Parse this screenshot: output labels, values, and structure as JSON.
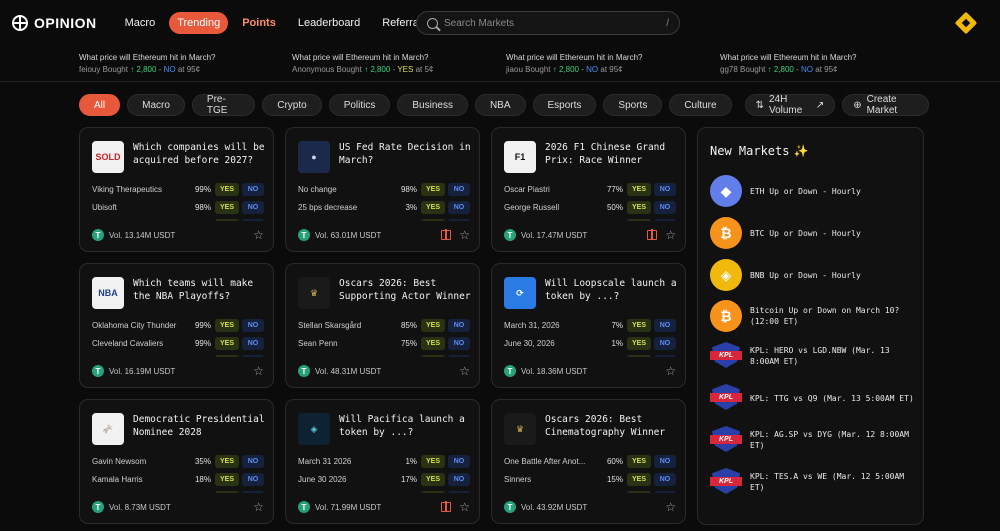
{
  "header": {
    "logo": "OPINION",
    "nav": [
      {
        "label": "Macro"
      },
      {
        "label": "Trending"
      },
      {
        "label": "Points"
      },
      {
        "label": "Leaderboard"
      },
      {
        "label": "Referral"
      }
    ],
    "search_placeholder": "Search Markets",
    "search_shortcut": "/"
  },
  "ticker": [
    {
      "question": "What price will Ethereum hit in March?",
      "user": "feiouy",
      "bought": "Bought",
      "arrow": "↑",
      "amount": "2,800",
      "dash": "-",
      "side": "NO",
      "at": "at 95¢"
    },
    {
      "question": "What price will Ethereum hit in March?",
      "user": "Anonymous",
      "bought": "Bought",
      "arrow": "↑",
      "amount": "2,800",
      "dash": "-",
      "side": "YES",
      "at": "at 5¢"
    },
    {
      "question": "What price will Ethereum hit in March?",
      "user": "jiaou",
      "bought": "Bought",
      "arrow": "↑",
      "amount": "2,800",
      "dash": "-",
      "side": "NO",
      "at": "at 95¢"
    },
    {
      "question": "What price will Ethereum hit in March?",
      "user": "gg78",
      "bought": "Bought",
      "arrow": "↑",
      "amount": "2,800",
      "dash": "-",
      "side": "NO",
      "at": "at 95¢"
    }
  ],
  "filters": [
    "All",
    "Macro",
    "Pre-TGE",
    "Crypto",
    "Politics",
    "Business",
    "NBA",
    "Esports",
    "Sports",
    "Culture"
  ],
  "sort_label": "24H Volume",
  "create_label": "Create Market",
  "yes_label": "YES",
  "no_label": "NO",
  "cards": [
    {
      "title": "Which companies will be acquired before 2027?",
      "thumb": "SOLD",
      "rows": [
        {
          "name": "Viking Therapeutics",
          "pct": "99%"
        },
        {
          "name": "Ubisoft",
          "pct": "98%"
        },
        {
          "name": "",
          "pct": ""
        }
      ],
      "volume": "Vol. 13.14M USDT",
      "gift": false
    },
    {
      "title": "US Fed Rate Decision in March?",
      "thumb": "",
      "rows": [
        {
          "name": "No change",
          "pct": "98%"
        },
        {
          "name": "25 bps decrease",
          "pct": "3%"
        },
        {
          "name": "",
          "pct": ""
        }
      ],
      "volume": "Vol. 63.01M USDT",
      "gift": true
    },
    {
      "title": "2026 F1 Chinese Grand Prix: Race Winner",
      "thumb": "F1",
      "rows": [
        {
          "name": "Oscar Piastri",
          "pct": "77%"
        },
        {
          "name": "George Russell",
          "pct": "50%"
        },
        {
          "name": "",
          "pct": ""
        }
      ],
      "volume": "Vol. 17.47M USDT",
      "gift": true
    },
    {
      "title": "Which teams will make the NBA Playoffs?",
      "thumb": "NBA",
      "rows": [
        {
          "name": "Oklahoma City Thunder",
          "pct": "99%"
        },
        {
          "name": "Cleveland Cavaliers",
          "pct": "99%"
        },
        {
          "name": "",
          "pct": ""
        }
      ],
      "volume": "Vol. 16.19M USDT",
      "gift": false
    },
    {
      "title": "Oscars 2026: Best Supporting Actor Winner",
      "thumb": "",
      "rows": [
        {
          "name": "Stellan Skarsgård",
          "pct": "85%"
        },
        {
          "name": "Sean Penn",
          "pct": "75%"
        },
        {
          "name": "",
          "pct": ""
        }
      ],
      "volume": "Vol. 48.31M USDT",
      "gift": false
    },
    {
      "title": "Will Loopscale launch a token by ...?",
      "thumb": "",
      "rows": [
        {
          "name": "March 31, 2026",
          "pct": "7%"
        },
        {
          "name": "June 30, 2026",
          "pct": "1%"
        },
        {
          "name": "",
          "pct": ""
        }
      ],
      "volume": "Vol. 18.36M USDT",
      "gift": false
    },
    {
      "title": "Democratic Presidential Nominee 2028",
      "thumb": "",
      "rows": [
        {
          "name": "Gavin Newsom",
          "pct": "35%"
        },
        {
          "name": "Kamala Harris",
          "pct": "18%"
        },
        {
          "name": "",
          "pct": ""
        }
      ],
      "volume": "Vol. 8.73M USDT",
      "gift": false
    },
    {
      "title": "Will Pacifica launch a token by ...?",
      "thumb": "",
      "rows": [
        {
          "name": "March 31 2026",
          "pct": "1%"
        },
        {
          "name": "June 30 2026",
          "pct": "17%"
        },
        {
          "name": "",
          "pct": ""
        }
      ],
      "volume": "Vol. 71.99M USDT",
      "gift": true
    },
    {
      "title": "Oscars 2026: Best Cinematography Winner",
      "thumb": "",
      "rows": [
        {
          "name": "One Battle After Anot...",
          "pct": "60%"
        },
        {
          "name": "Sinners",
          "pct": "15%"
        },
        {
          "name": "",
          "pct": ""
        }
      ],
      "volume": "Vol. 43.92M USDT",
      "gift": false
    }
  ],
  "sidebar": {
    "title": "New Markets",
    "sparkle": "✨",
    "items": [
      {
        "label": "ETH Up or Down - Hourly",
        "icon": "ethereum-icon",
        "color": "#627eea",
        "glyph": "◆"
      },
      {
        "label": "BTC Up or Down - Hourly",
        "icon": "bitcoin-icon",
        "color": "#f7931a",
        "glyph": "₿"
      },
      {
        "label": "BNB Up or Down - Hourly",
        "icon": "bnb-icon",
        "color": "#f0b90b",
        "glyph": "◈"
      },
      {
        "label": "Bitcoin Up or Down on March 10? (12:00 ET)",
        "icon": "bitcoin-icon",
        "color": "#f7931a",
        "glyph": "₿"
      },
      {
        "label": "KPL: HERO vs LGD.NBW (Mar. 13 8:00AM ET)",
        "icon": "kpl-logo-icon",
        "kpl": "KPL"
      },
      {
        "label": "KPL: TTG vs Q9 (Mar. 13 5:00AM ET)",
        "icon": "kpl-logo-icon",
        "kpl": "KPL"
      },
      {
        "label": "KPL: AG.SP vs DYG (Mar. 12 8:00AM ET)",
        "icon": "kpl-logo-icon",
        "kpl": "KPL"
      },
      {
        "label": "KPL: TES.A vs WE (Mar. 12 5:00AM ET)",
        "icon": "kpl-logo-icon",
        "kpl": "KPL"
      }
    ]
  },
  "colors": {
    "accent": "#e8583a",
    "yes": "#d6e04a",
    "no": "#4a8bf5",
    "up": "#3ccf7a"
  }
}
